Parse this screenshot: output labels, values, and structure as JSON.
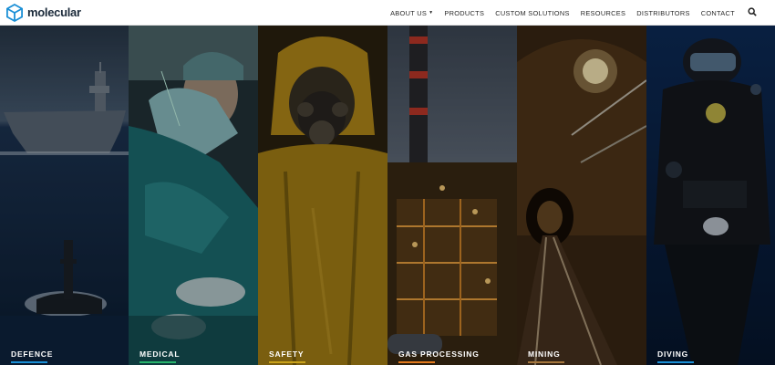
{
  "brand": {
    "name": "molecular",
    "accent": "#1a8fd6"
  },
  "nav": {
    "items": [
      {
        "label": "ABOUT US",
        "has_dropdown": true
      },
      {
        "label": "PRODUCTS",
        "has_dropdown": false
      },
      {
        "label": "CUSTOM SOLUTIONS",
        "has_dropdown": false
      },
      {
        "label": "RESOURCES",
        "has_dropdown": false
      },
      {
        "label": "DISTRIBUTORS",
        "has_dropdown": false
      },
      {
        "label": "CONTACT",
        "has_dropdown": false
      }
    ],
    "search_icon": "search-icon"
  },
  "panels": [
    {
      "label": "DEFENCE",
      "underline_color": "#1a8fd6"
    },
    {
      "label": "MEDICAL",
      "underline_color": "#27b36b"
    },
    {
      "label": "SAFETY",
      "underline_color": "#c9a21b"
    },
    {
      "label": "GAS PROCESSING",
      "underline_color": "#e37a1d"
    },
    {
      "label": "MINING",
      "underline_color": "#a5763d"
    },
    {
      "label": "DIVING",
      "underline_color": "#1a8fd6"
    }
  ]
}
